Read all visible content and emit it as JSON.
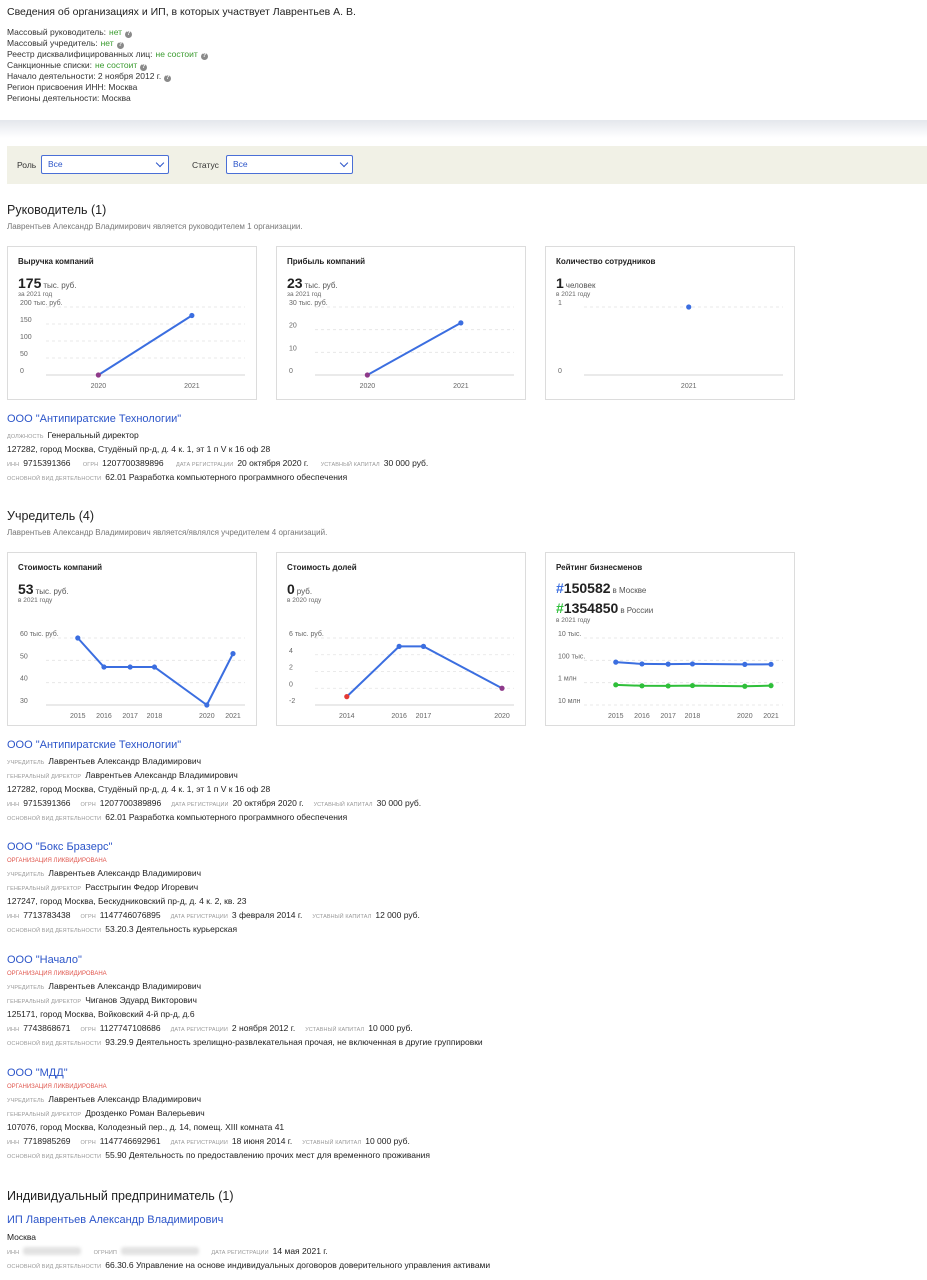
{
  "header": {
    "title": "Сведения об организациях и ИП, в которых участвует Лаврентьев А. В.",
    "lines": [
      {
        "label": "Массовый руководитель:",
        "value": "нет",
        "help": true
      },
      {
        "label": "Массовый учредитель:",
        "value": "нет",
        "help": true
      },
      {
        "label": "Реестр дисквалифицированных лиц:",
        "value": "не состоит",
        "help": true
      },
      {
        "label": "Санкционные списки:",
        "value": "не состоит",
        "help": true
      },
      {
        "label": "Начало деятельности: 2 ноября 2012 г.",
        "value": "",
        "help": true
      },
      {
        "label": "Регион присвоения ИНН: Москва",
        "value": "",
        "help": false
      },
      {
        "label": "Регионы деятельности: Москва",
        "value": "",
        "help": false
      }
    ]
  },
  "filters": {
    "role_label": "Роль",
    "role_value": "Все",
    "status_label": "Статус",
    "status_value": "Все"
  },
  "director_section": {
    "heading": "Руководитель (1)",
    "subtitle": "Лаврентьев Александр Владимирович является руководителем 1 организации.",
    "cards": [
      {
        "title": "Выручка компаний",
        "value": "175",
        "unit": "тыс. руб.",
        "period": "за 2021 год",
        "unit_label": "200 тыс. руб."
      },
      {
        "title": "Прибыль компаний",
        "value": "23",
        "unit": "тыс. руб.",
        "period": "за 2021 год",
        "unit_label": "30 тыс. руб."
      },
      {
        "title": "Количество сотрудников",
        "value": "1",
        "unit": "человек",
        "period": "в 2021 году",
        "unit_label": "1"
      }
    ],
    "orgs": [
      {
        "name": "ООО \"Антипиратские Технологии\"",
        "position_label": "должность",
        "position": "Генеральный директор",
        "address": "127282, город Москва, Студёный пр-д, д. 4 к. 1, эт 1 п V к 16 оф 28",
        "inn": "9715391366",
        "ogrn": "1207700389896",
        "reg_date": "20 октября 2020 г.",
        "capital": "30 000 руб.",
        "activity": "62.01 Разработка компьютерного программного обеспечения"
      }
    ]
  },
  "founder_section": {
    "heading": "Учредитель (4)",
    "subtitle": "Лаврентьев Александр Владимирович является/являлся учредителем 4 организаций.",
    "cards": [
      {
        "title": "Стоимость компаний",
        "value": "53",
        "unit": "тыс. руб.",
        "period": "в 2021 году",
        "unit_label": "60 тыс. руб."
      },
      {
        "title": "Стоимость долей",
        "value": "0",
        "unit": "руб.",
        "period": "в 2020 году",
        "unit_label": "6 тыс. руб."
      },
      {
        "title": "Рейтинг бизнесменов",
        "moscow_rank": "150582",
        "moscow_label": "в Москве",
        "russia_rank": "1354850",
        "russia_label": "в России",
        "period": "в 2021 году"
      }
    ],
    "orgs": [
      {
        "name": "ООО \"Антипиратские Технологии\"",
        "liquidated": "",
        "founder": "Лаврентьев Александр Владимирович",
        "director": "Лаврентьев Александр Владимирович",
        "address": "127282, город Москва, Студёный пр-д, д. 4 к. 1, эт 1 п V к 16 оф 28",
        "inn": "9715391366",
        "ogrn": "1207700389896",
        "reg_date": "20 октября 2020 г.",
        "capital": "30 000 руб.",
        "activity": "62.01 Разработка компьютерного программного обеспечения"
      },
      {
        "name": "ООО \"Бокс Бразерс\"",
        "liquidated": "организация ликвидирована",
        "founder": "Лаврентьев Александр Владимирович",
        "director": "Расстрыгин Федор Игоревич",
        "address": "127247, город Москва, Бескудниковский пр-д, д. 4 к. 2, кв. 23",
        "inn": "7713783438",
        "ogrn": "1147746076895",
        "reg_date": "3 февраля 2014 г.",
        "capital": "12 000 руб.",
        "activity": "53.20.3 Деятельность курьерская"
      },
      {
        "name": "ООО \"Начало\"",
        "liquidated": "организация ликвидирована",
        "founder": "Лаврентьев Александр Владимирович",
        "director": "Чиганов Эдуард Викторович",
        "address": "125171, город Москва, Войковский 4-й пр-д, д.6",
        "inn": "7743868671",
        "ogrn": "1127747108686",
        "reg_date": "2 ноября 2012 г.",
        "capital": "10 000 руб.",
        "activity": "93.29.9 Деятельность зрелищно-развлекательная прочая, не включенная в другие группировки"
      },
      {
        "name": "ООО \"МДД\"",
        "liquidated": "организация ликвидирована",
        "founder": "Лаврентьев Александр Владимирович",
        "director": "Дрозденко Роман Валерьевич",
        "address": "107076, город Москва, Колодезный пер., д. 14, помещ. XIII комната 41",
        "inn": "7718985269",
        "ogrn": "1147746692961",
        "reg_date": "18 июня 2014 г.",
        "capital": "10 000 руб.",
        "activity": "55.90 Деятельность по предоставлению прочих мест для временного проживания"
      }
    ]
  },
  "ip_section": {
    "heading": "Индивидуальный предприниматель (1)",
    "name": "ИП Лаврентьев Александр Владимирович",
    "city": "Москва",
    "reg_date": "14 мая 2021 г.",
    "activity": "66.30.6 Управление на основе индивидуальных договоров доверительного управления активами"
  },
  "labels": {
    "founder": "учредитель",
    "director": "генеральный директор",
    "inn": "инн",
    "ogrn": "огрн",
    "ogrnip": "огрнип",
    "reg_date": "дата регистрации",
    "capital": "уставный капитал",
    "activity": "основной вид деятельности"
  },
  "colors": {
    "accent": "#2c55c9",
    "line": "#3b6ee0",
    "green": "#2fbf3a",
    "danger": "#e0564d",
    "filter_bg": "#f1f1e6"
  },
  "chart_data": [
    {
      "type": "line",
      "title": "Выручка компаний",
      "x": [
        "2020",
        "2021"
      ],
      "series": [
        {
          "values": [
            0,
            175
          ]
        }
      ],
      "ylim": [
        0,
        200
      ],
      "yticks": [
        "0",
        "50",
        "100",
        "150",
        "200 тыс. руб."
      ],
      "grid": true
    },
    {
      "type": "line",
      "title": "Прибыль компаний",
      "x": [
        "2020",
        "2021"
      ],
      "series": [
        {
          "values": [
            0,
            23
          ]
        }
      ],
      "ylim": [
        0,
        30
      ],
      "yticks": [
        "0",
        "10",
        "20",
        "30 тыс. руб."
      ],
      "grid": true
    },
    {
      "type": "scatter",
      "title": "Количество сотрудников",
      "x": [
        "2021"
      ],
      "series": [
        {
          "values": [
            1
          ]
        }
      ],
      "ylim": [
        0,
        1
      ],
      "yticks": [
        "0",
        "1"
      ],
      "grid": true
    },
    {
      "type": "line",
      "title": "Стоимость компаний",
      "x": [
        "2015",
        "2016",
        "2017",
        "2018",
        "2020",
        "2021"
      ],
      "series": [
        {
          "values": [
            60,
            47,
            47,
            47,
            30,
            53
          ]
        }
      ],
      "ylim": [
        30,
        60
      ],
      "yticks": [
        "30",
        "40",
        "50",
        "60 тыс. руб."
      ],
      "grid": true
    },
    {
      "type": "line",
      "title": "Стоимость долей",
      "x": [
        "2014",
        "2016",
        "2017",
        "2020"
      ],
      "series": [
        {
          "values": [
            -1,
            5,
            5,
            0
          ]
        }
      ],
      "ylim": [
        -2,
        6
      ],
      "yticks": [
        "-2",
        "0",
        "2",
        "4",
        "6 тыс. руб."
      ],
      "grid": true
    },
    {
      "type": "line",
      "title": "Рейтинг бизнесменов",
      "x": [
        "2015",
        "2016",
        "2017",
        "2018",
        "2020",
        "2021"
      ],
      "series": [
        {
          "values": [
            120000,
            145000,
            148000,
            145000,
            152000,
            150582
          ],
          "color": "#3b6ee0"
        },
        {
          "values": [
            1250000,
            1380000,
            1400000,
            1350000,
            1450000,
            1354850
          ],
          "color": "#2fbf3a"
        }
      ],
      "log_scale": true,
      "yticks": [
        "10 тыс.",
        "100 тыс.",
        "1 млн",
        "10 млн"
      ],
      "grid": true
    }
  ]
}
